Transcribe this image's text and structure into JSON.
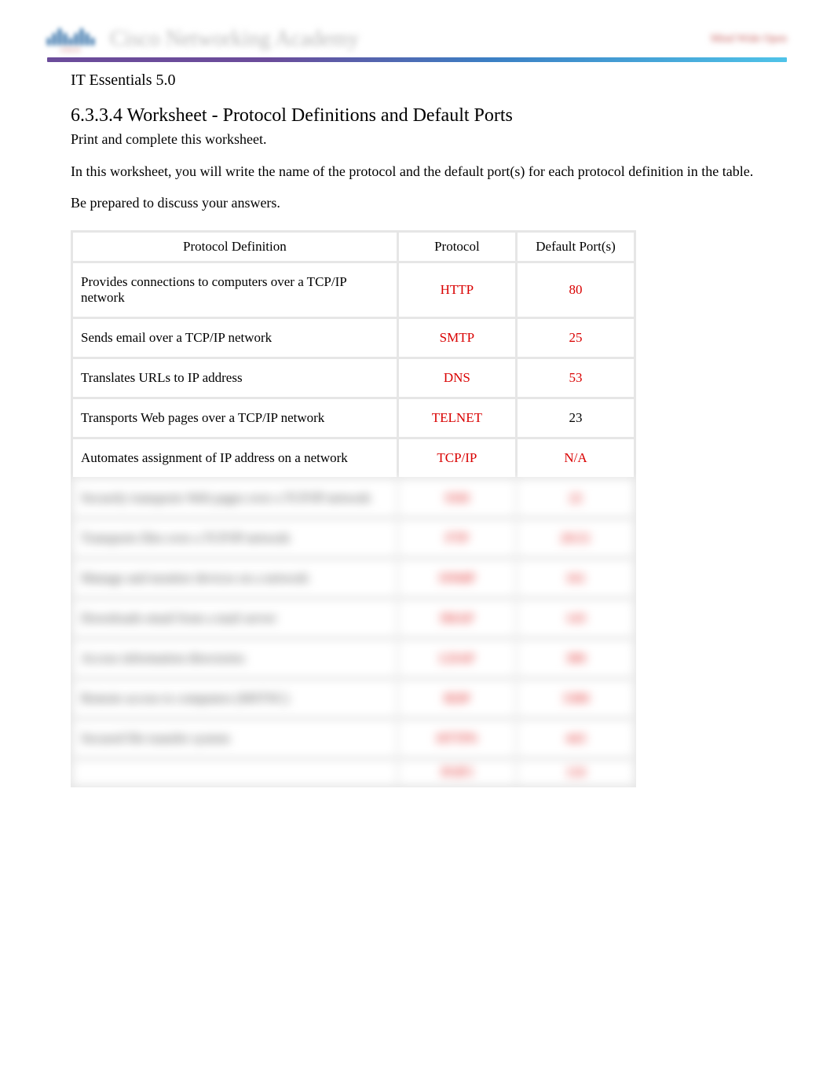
{
  "header": {
    "logo_text": "cisco",
    "academy_label": "Cisco Networking Academy",
    "right_text": "Mind Wide Open"
  },
  "course": "IT Essentials 5.0",
  "title": "6.3.3.4 Worksheet - Protocol Definitions and Default Ports",
  "instruction": "Print and complete this worksheet.",
  "description": "In this worksheet, you will write the name of the protocol and the default port(s) for each protocol definition in the table.",
  "prepared": "Be prepared to discuss your answers.",
  "table": {
    "headers": {
      "definition": "Protocol Definition",
      "protocol": "Protocol",
      "port": "Default Port(s)"
    },
    "rows": [
      {
        "definition": "Provides connections to computers over a TCP/IP network",
        "protocol": "HTTP",
        "port": "80",
        "blur": false,
        "black_port": false
      },
      {
        "definition": "Sends email over a TCP/IP network",
        "protocol": "SMTP",
        "port": "25",
        "blur": false,
        "black_port": false
      },
      {
        "definition": "Translates URLs to IP address",
        "protocol": "DNS",
        "port": "53",
        "blur": false,
        "black_port": false
      },
      {
        "definition": "Transports Web pages over a TCP/IP network",
        "protocol": "TELNET",
        "port": "23",
        "blur": false,
        "black_port": true
      },
      {
        "definition": "Automates assignment of IP address on a network",
        "protocol": "TCP/IP",
        "port": "N/A",
        "blur": false,
        "black_port": false
      },
      {
        "definition": "Securely transports Web pages over a TCP/IP network",
        "protocol": "SSH",
        "port": "22",
        "blur": true,
        "black_port": false
      },
      {
        "definition": "Transports files over a TCP/IP network",
        "protocol": "FTP",
        "port": "20/21",
        "blur": true,
        "black_port": false
      },
      {
        "definition": "Manage and monitor devices on a network",
        "protocol": "SNMP",
        "port": "161",
        "blur": true,
        "black_port": false
      },
      {
        "definition": "Downloads email from a mail server",
        "protocol": "IMAP",
        "port": "143",
        "blur": true,
        "black_port": false
      },
      {
        "definition": "Access information directories",
        "protocol": "LDAP",
        "port": "389",
        "blur": true,
        "black_port": false
      },
      {
        "definition": "Remote access to computers (MSTSC)",
        "protocol": "RDP",
        "port": "3389",
        "blur": true,
        "black_port": false
      },
      {
        "definition": "Secured file transfer system",
        "protocol": "HTTPS",
        "port": "443",
        "blur": true,
        "black_port": false
      },
      {
        "definition": "",
        "protocol": "POP3",
        "port": "110",
        "blur": true,
        "black_port": false
      }
    ]
  }
}
